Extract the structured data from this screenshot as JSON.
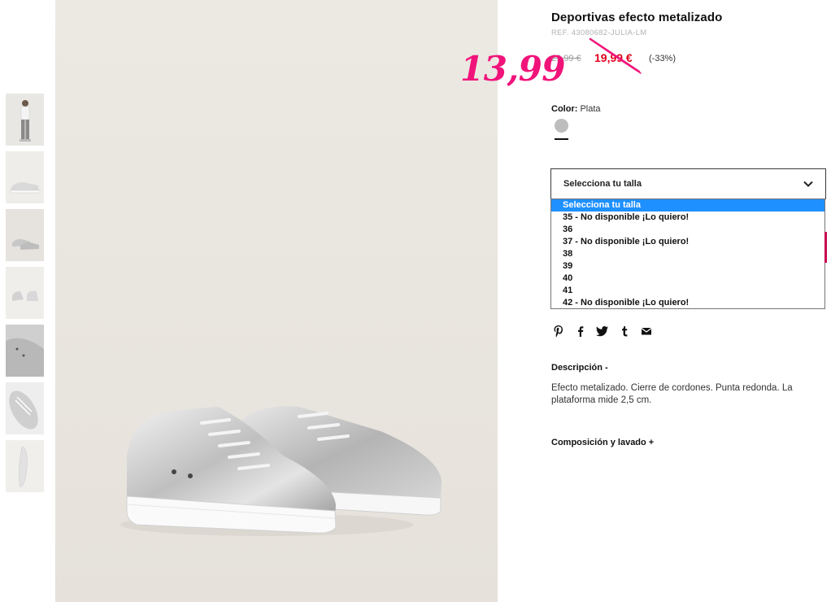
{
  "product": {
    "title": "Deportivas efecto metalizado",
    "ref": "REF. 43080682-JULIA-LM",
    "old_price": "29,99 €",
    "sale_price": "19,99 €",
    "discount": "(-33%)",
    "handwritten_price": "13,99"
  },
  "color": {
    "label": "Color:",
    "value": "Plata",
    "swatch_hex": "#bdbdbd"
  },
  "size_select": {
    "current": "Selecciona tu talla",
    "options": [
      "Selecciona tu talla",
      "35 - No disponible ¡Lo quiero!",
      "36",
      "37 - No disponible ¡Lo quiero!",
      "38",
      "39",
      "40",
      "41",
      "42 - No disponible ¡Lo quiero!"
    ]
  },
  "share": {
    "icons": [
      "pinterest-icon",
      "facebook-icon",
      "twitter-icon",
      "tumblr-icon",
      "email-icon"
    ]
  },
  "description": {
    "title": "Descripción -",
    "text": "Efecto metalizado. Cierre de cordones. Punta redonda. La plataforma mide 2,5 cm."
  },
  "composition": {
    "title": "Composición y lavado +"
  },
  "colors": {
    "sale_red": "#e2001a",
    "handwritten_pink": "#f0147a",
    "select_highlight": "#1e90ff",
    "accent": "#c6004f"
  }
}
